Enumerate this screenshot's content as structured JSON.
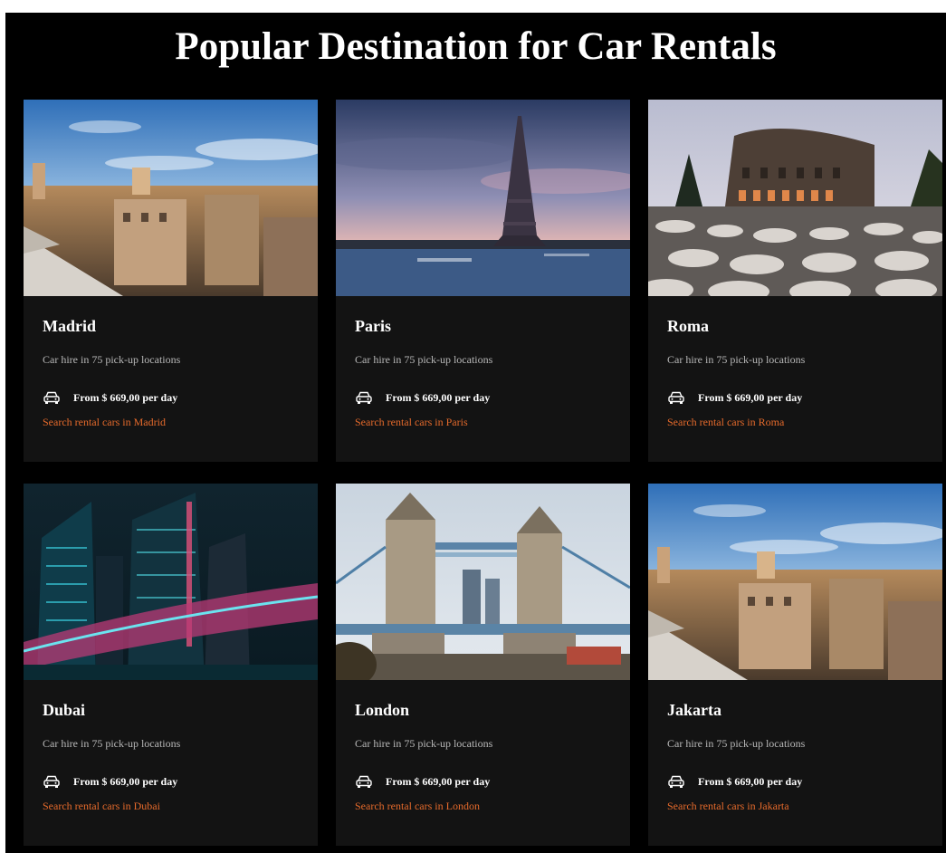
{
  "page": {
    "title": "Popular Destination for Car Rentals"
  },
  "cards": [
    {
      "city": "Madrid",
      "locations": "Car hire in 75 pick-up locations",
      "price": "From $ 669,00 per day",
      "link": "Search rental cars in Madrid",
      "icon": "car-icon"
    },
    {
      "city": "Paris",
      "locations": "Car hire in 75 pick-up locations",
      "price": "From $ 669,00 per day",
      "link": "Search rental cars in Paris",
      "icon": "car-icon"
    },
    {
      "city": "Roma",
      "locations": "Car hire in 75 pick-up locations",
      "price": "From $ 669,00 per day",
      "link": "Search rental cars in Roma",
      "icon": "car-icon"
    },
    {
      "city": "Dubai",
      "locations": "Car hire in 75 pick-up locations",
      "price": "From $ 669,00 per day",
      "link": "Search rental cars in Dubai",
      "icon": "car-icon"
    },
    {
      "city": "London",
      "locations": "Car hire in 75 pick-up locations",
      "price": "From $ 669,00 per day",
      "link": "Search rental cars in London",
      "icon": "car-icon"
    },
    {
      "city": "Jakarta",
      "locations": "Car hire in 75 pick-up locations",
      "price": "From $ 669,00 per day",
      "link": "Search rental cars in Jakarta",
      "icon": "car-icon"
    }
  ],
  "colors": {
    "background": "#000000",
    "card": "#131313",
    "accent_link": "#e56a2b",
    "muted_text": "#b8b8b8"
  }
}
